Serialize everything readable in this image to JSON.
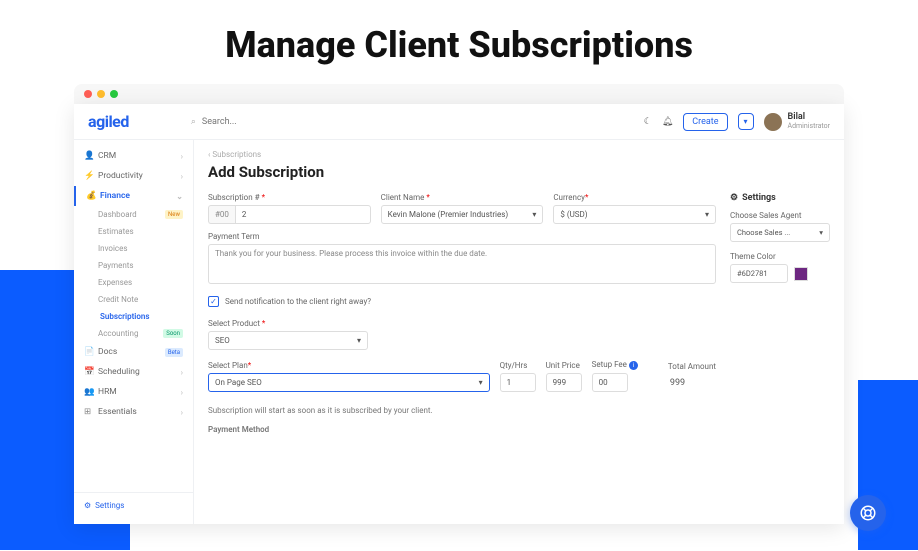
{
  "hero": "Manage Client Subscriptions",
  "brand": "agiled",
  "search": {
    "placeholder": "Search..."
  },
  "topbar": {
    "create": "Create",
    "user_name": "Bilal",
    "user_role": "Administrator"
  },
  "nav": {
    "crm": "CRM",
    "productivity": "Productivity",
    "finance": "Finance",
    "dashboard": "Dashboard",
    "estimates": "Estimates",
    "invoices": "Invoices",
    "payments": "Payments",
    "expenses": "Expenses",
    "credit_note": "Credit Note",
    "subscriptions": "Subscriptions",
    "accounting": "Accounting",
    "docs": "Docs",
    "scheduling": "Scheduling",
    "hrm": "HRM",
    "essentials": "Essentials",
    "settings": "Settings",
    "badge_new": "New",
    "badge_soon": "Soon",
    "badge_beta": "Beta"
  },
  "breadcrumb": "‹ Subscriptions",
  "page_title": "Add Subscription",
  "form": {
    "sub_num_label": "Subscription #",
    "sub_prefix": "#00",
    "sub_value": "2",
    "client_label": "Client Name",
    "client_value": "Kevin Malone (Premier Industries)",
    "currency_label": "Currency",
    "currency_value": "$ (USD)",
    "payment_term_label": "Payment Term",
    "payment_term_value": "Thank you for your business. Please process this invoice within the due date.",
    "notify_label": "Send notification to the client right away?",
    "product_label": "Select Product",
    "product_value": "SEO",
    "plan_label": "Select Plan",
    "plan_value": "On Page SEO",
    "qty_label": "Qty/Hrs",
    "qty_value": "1",
    "price_label": "Unit Price",
    "price_value": "999",
    "setup_label": "Setup Fee",
    "setup_value": "00",
    "total_label": "Total Amount",
    "total_value": "999",
    "start_note": "Subscription will start as soon as it is subscribed by your client.",
    "payment_method": "Payment Method"
  },
  "settings": {
    "title": "Settings",
    "agent_label": "Choose Sales Agent",
    "agent_value": "Choose Sales ...",
    "color_label": "Theme Color",
    "color_value": "#6D2781"
  }
}
